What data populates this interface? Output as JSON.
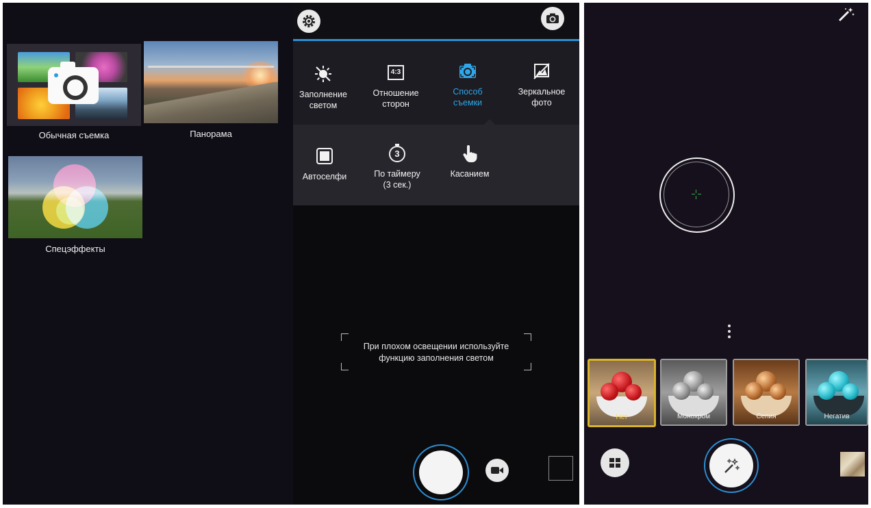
{
  "modes_panel": {
    "modes": [
      {
        "label": "Обычная съемка",
        "icon": "camera-icon"
      },
      {
        "label": "Панорама",
        "icon": "panorama-thumbnail"
      },
      {
        "label": "Спецэффекты",
        "icon": "effects-thumbnail"
      }
    ]
  },
  "settings_panel": {
    "top_icons": [
      "gear-icon",
      "switch-camera-icon"
    ],
    "menu_row1": [
      {
        "line1": "Заполнение",
        "line2": "светом",
        "icon": "fill-light-icon",
        "active": false
      },
      {
        "line1": "Отношение",
        "line2": "сторон",
        "icon": "aspect-ratio-icon",
        "icon_text": "4:3",
        "active": false
      },
      {
        "line1": "Способ",
        "line2": "съемки",
        "icon": "shooting-mode-icon",
        "active": true
      },
      {
        "line1": "Зеркальное",
        "line2": "фото",
        "icon": "mirror-photo-icon",
        "active": false
      }
    ],
    "menu_row2": [
      {
        "line1": "Автоселфи",
        "line2": "",
        "icon": "auto-selfie-icon"
      },
      {
        "line1": "По таймеру",
        "line2": "(3 сек.)",
        "icon": "timer-icon",
        "icon_text": "3"
      },
      {
        "line1": "Касанием",
        "line2": "",
        "icon": "touch-icon"
      }
    ],
    "hint": {
      "line1": "При плохом освещении используйте",
      "line2": "функцию заполнения светом"
    },
    "accent_color": "#2fa6e9"
  },
  "effects_panel": {
    "filters": [
      {
        "label": "Нет",
        "selected": true,
        "tone": "color"
      },
      {
        "label": "Монохром",
        "selected": false,
        "tone": "mono"
      },
      {
        "label": "Сепия",
        "selected": false,
        "tone": "sepia"
      },
      {
        "label": "Негатив",
        "selected": false,
        "tone": "negative"
      }
    ],
    "selected_color": "#d9b32c"
  }
}
